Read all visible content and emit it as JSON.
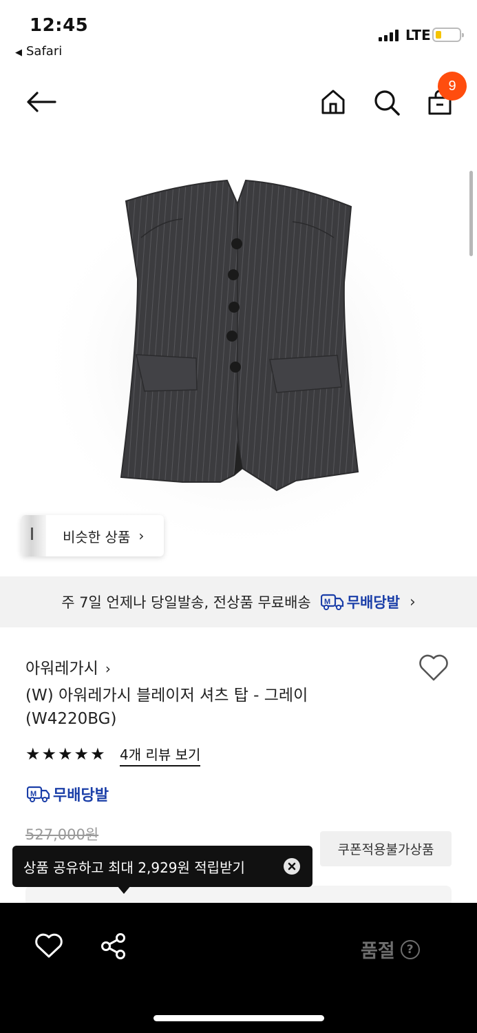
{
  "status_bar": {
    "time": "12:45",
    "back_app": "Safari",
    "network": "LTE"
  },
  "nav": {
    "cart_count": "9",
    "icons": [
      "back-arrow-icon",
      "home-icon",
      "search-icon",
      "shopping-bag-icon"
    ]
  },
  "hero": {
    "similar_products": "비슷한 상품"
  },
  "shipping": {
    "text": "주 7일 언제나 당일발송, 전상품 무료배송",
    "badge": "무배당발"
  },
  "product": {
    "brand": "아워레가시",
    "title_line1": "(W) 아워레가시 블레이저 셔츠 탑 - 그레이",
    "title_line2": "(W4220BG)",
    "rating_stars": 5,
    "review_link": "4개 리뷰 보기",
    "delivery_badge": "무배당발",
    "original_price": "527,000원",
    "coupon_label": "쿠폰적용불가상품"
  },
  "toast": {
    "text": "상품 공유하고 최대 2,929원 적립받기"
  },
  "bottom_bar": {
    "status": "품절",
    "help_glyph": "?"
  },
  "colors": {
    "badge": "#ff4d0e",
    "brand_blue": "#1a3ea8",
    "bottom_bar": "#000000"
  }
}
